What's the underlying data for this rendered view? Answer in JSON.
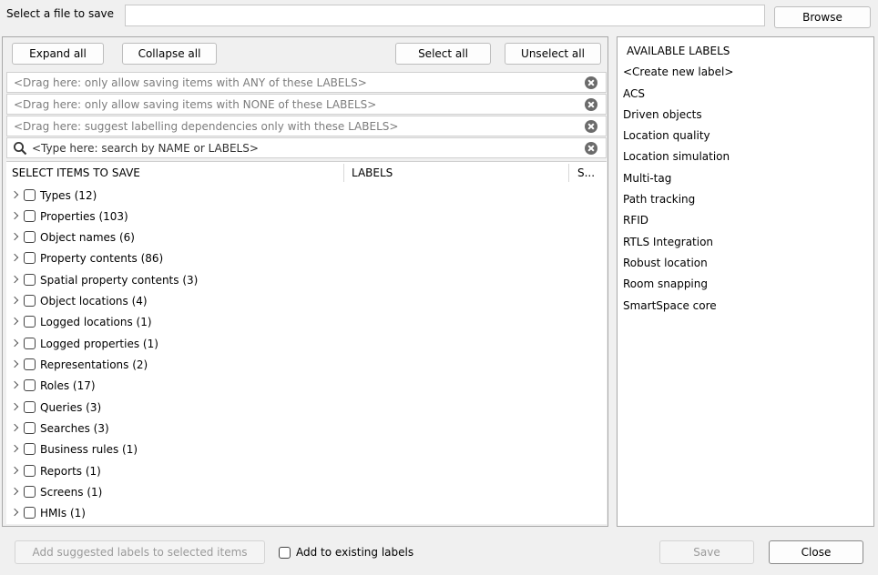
{
  "file": {
    "label": "Select a file to save",
    "path_value": "",
    "browse_label": "Browse"
  },
  "toolbar": {
    "expand_all": "Expand all",
    "collapse_all": "Collapse all",
    "select_all": "Select all",
    "unselect_all": "Unselect all"
  },
  "filters": {
    "any_labels": "<Drag here: only allow saving items with ANY of these LABELS>",
    "none_labels": "<Drag here: only allow saving items with NONE of these LABELS>",
    "dependencies": "<Drag here: suggest labelling dependencies only with these LABELS>",
    "search_placeholder": "<Type here: search by NAME or LABELS>"
  },
  "table": {
    "columns": [
      "SELECT ITEMS TO SAVE",
      "LABELS",
      "S..."
    ],
    "items": [
      "Types (12)",
      "Properties (103)",
      "Object names (6)",
      "Property contents (86)",
      "Spatial property contents (3)",
      "Object locations (4)",
      "Logged locations (1)",
      "Logged properties (1)",
      "Representations (2)",
      "Roles (17)",
      "Queries (3)",
      "Searches (3)",
      "Business rules (1)",
      "Reports (1)",
      "Screens (1)",
      "HMIs (1)"
    ]
  },
  "labels_panel": {
    "header": "AVAILABLE LABELS",
    "items": [
      "<Create new label>",
      "ACS",
      "Driven objects",
      "Location quality",
      "Location simulation",
      "Multi-tag",
      "Path tracking",
      "RFID",
      "RTLS Integration",
      "Robust location",
      "Room snapping",
      "SmartSpace core"
    ]
  },
  "footer": {
    "add_suggested": "Add suggested labels to selected items",
    "add_existing": "Add to existing labels",
    "save": "Save",
    "close": "Close"
  },
  "icons": {
    "clear": "clear-circle-x-icon",
    "search": "magnifier-icon",
    "expand": "chevron-right-icon"
  },
  "colors": {
    "background": "#f0f0f0",
    "panel": "#ffffff",
    "hint_text": "#7d7d7d",
    "disabled_text": "#9a9a9a"
  }
}
